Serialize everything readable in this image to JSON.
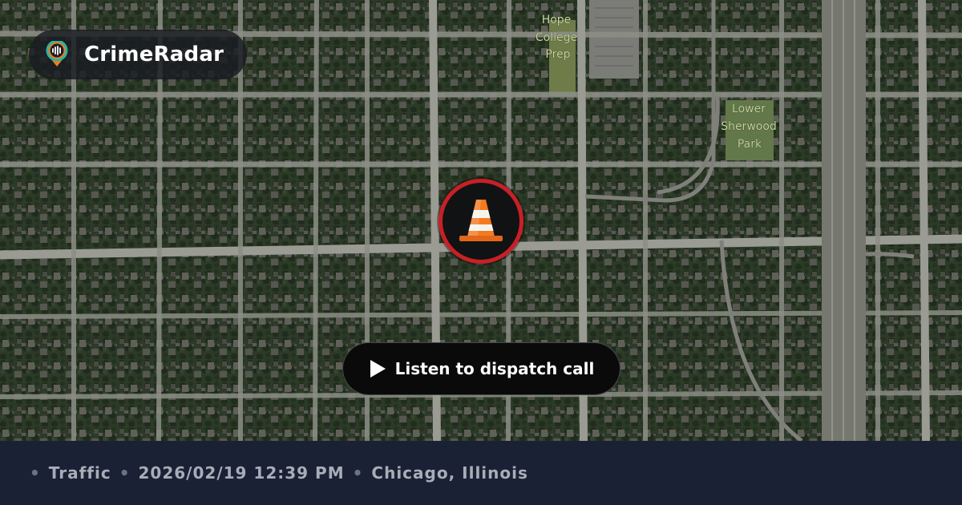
{
  "brand": {
    "name": "CrimeRadar",
    "logo_icon": "radar-pin-icon"
  },
  "map": {
    "labels": [
      {
        "text": "Hope"
      },
      {
        "text": "College"
      },
      {
        "text": "Prep"
      },
      {
        "text": "Lower"
      },
      {
        "text": "Sherwood"
      },
      {
        "text": "Park"
      }
    ],
    "colors": {
      "vegetation": "#2f3d29",
      "roads": "#8b8d84",
      "highway": "#6f716c",
      "label": "#c7d49a"
    }
  },
  "incident_marker": {
    "icon": "traffic-cone-icon",
    "ring_color": "#c91f26",
    "fill_color": "#111214",
    "cone_color": "#f47a1f"
  },
  "listen_button": {
    "label": "Listen to dispatch call",
    "icon": "play-icon"
  },
  "footer": {
    "separator": "•",
    "category": "Traffic",
    "datetime": "2026/02/19 12:39 PM",
    "location": "Chicago, Illinois"
  }
}
